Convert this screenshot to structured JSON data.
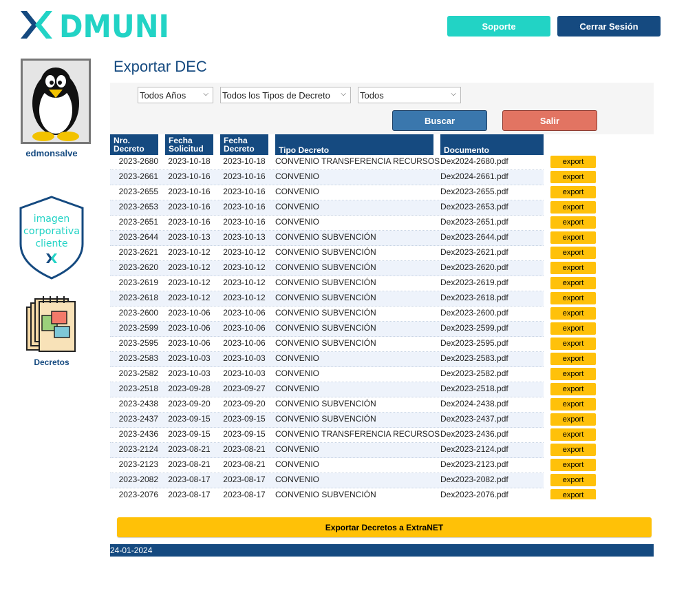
{
  "app": {
    "brand": "DMUNI"
  },
  "header": {
    "soporte_label": "Soporte",
    "cerrar_label": "Cerrar Sesión"
  },
  "sidebar": {
    "username": "edmonsalve",
    "shield_text": [
      "imagen",
      "corporativa",
      "cliente"
    ],
    "decretos_label": "Decretos"
  },
  "page": {
    "title": "Exportar DEC"
  },
  "filters": {
    "anos": "Todos Años",
    "tipos": "Todos los Tipos de Decreto",
    "todos": "Todos",
    "buscar_label": "Buscar",
    "salir_label": "Salir"
  },
  "table": {
    "headers": {
      "nro": [
        "Nro.",
        "Decreto"
      ],
      "solicitud": [
        "Fecha",
        "Solicitud"
      ],
      "decreto": [
        "Fecha",
        "Decreto"
      ],
      "tipo": "Tipo Decreto",
      "documento": "Documento"
    },
    "export_label": "export",
    "rows": [
      {
        "nro": "2023-2680",
        "solicitud": "2023-10-18",
        "decreto": "2023-10-18",
        "tipo": "CONVENIO TRANSFERENCIA RECURSOS",
        "documento": "Dex2024-2680.pdf"
      },
      {
        "nro": "2023-2661",
        "solicitud": "2023-10-16",
        "decreto": "2023-10-16",
        "tipo": "CONVENIO",
        "documento": "Dex2024-2661.pdf"
      },
      {
        "nro": "2023-2655",
        "solicitud": "2023-10-16",
        "decreto": "2023-10-16",
        "tipo": "CONVENIO",
        "documento": "Dex2023-2655.pdf"
      },
      {
        "nro": "2023-2653",
        "solicitud": "2023-10-16",
        "decreto": "2023-10-16",
        "tipo": "CONVENIO",
        "documento": "Dex2023-2653.pdf"
      },
      {
        "nro": "2023-2651",
        "solicitud": "2023-10-16",
        "decreto": "2023-10-16",
        "tipo": "CONVENIO",
        "documento": "Dex2023-2651.pdf"
      },
      {
        "nro": "2023-2644",
        "solicitud": "2023-10-13",
        "decreto": "2023-10-13",
        "tipo": "CONVENIO SUBVENCIÓN",
        "documento": "Dex2023-2644.pdf"
      },
      {
        "nro": "2023-2621",
        "solicitud": "2023-10-12",
        "decreto": "2023-10-12",
        "tipo": "CONVENIO SUBVENCIÓN",
        "documento": "Dex2023-2621.pdf"
      },
      {
        "nro": "2023-2620",
        "solicitud": "2023-10-12",
        "decreto": "2023-10-12",
        "tipo": "CONVENIO SUBVENCIÓN",
        "documento": "Dex2023-2620.pdf"
      },
      {
        "nro": "2023-2619",
        "solicitud": "2023-10-12",
        "decreto": "2023-10-12",
        "tipo": "CONVENIO SUBVENCIÓN",
        "documento": "Dex2023-2619.pdf"
      },
      {
        "nro": "2023-2618",
        "solicitud": "2023-10-12",
        "decreto": "2023-10-12",
        "tipo": "CONVENIO SUBVENCIÓN",
        "documento": "Dex2023-2618.pdf"
      },
      {
        "nro": "2023-2600",
        "solicitud": "2023-10-06",
        "decreto": "2023-10-06",
        "tipo": "CONVENIO SUBVENCIÓN",
        "documento": "Dex2023-2600.pdf"
      },
      {
        "nro": "2023-2599",
        "solicitud": "2023-10-06",
        "decreto": "2023-10-06",
        "tipo": "CONVENIO SUBVENCIÓN",
        "documento": "Dex2023-2599.pdf"
      },
      {
        "nro": "2023-2595",
        "solicitud": "2023-10-06",
        "decreto": "2023-10-06",
        "tipo": "CONVENIO SUBVENCIÓN",
        "documento": "Dex2023-2595.pdf"
      },
      {
        "nro": "2023-2583",
        "solicitud": "2023-10-03",
        "decreto": "2023-10-03",
        "tipo": "CONVENIO",
        "documento": "Dex2023-2583.pdf"
      },
      {
        "nro": "2023-2582",
        "solicitud": "2023-10-03",
        "decreto": "2023-10-03",
        "tipo": "CONVENIO",
        "documento": "Dex2023-2582.pdf"
      },
      {
        "nro": "2023-2518",
        "solicitud": "2023-09-28",
        "decreto": "2023-09-27",
        "tipo": "CONVENIO",
        "documento": "Dex2023-2518.pdf"
      },
      {
        "nro": "2023-2438",
        "solicitud": "2023-09-20",
        "decreto": "2023-09-20",
        "tipo": "CONVENIO SUBVENCIÓN",
        "documento": "Dex2024-2438.pdf"
      },
      {
        "nro": "2023-2437",
        "solicitud": "2023-09-15",
        "decreto": "2023-09-15",
        "tipo": "CONVENIO SUBVENCIÓN",
        "documento": "Dex2023-2437.pdf"
      },
      {
        "nro": "2023-2436",
        "solicitud": "2023-09-15",
        "decreto": "2023-09-15",
        "tipo": "CONVENIO TRANSFERENCIA RECURSOS",
        "documento": "Dex2023-2436.pdf"
      },
      {
        "nro": "2023-2124",
        "solicitud": "2023-08-21",
        "decreto": "2023-08-21",
        "tipo": "CONVENIO",
        "documento": "Dex2023-2124.pdf"
      },
      {
        "nro": "2023-2123",
        "solicitud": "2023-08-21",
        "decreto": "2023-08-21",
        "tipo": "CONVENIO",
        "documento": "Dex2023-2123.pdf"
      },
      {
        "nro": "2023-2082",
        "solicitud": "2023-08-17",
        "decreto": "2023-08-17",
        "tipo": "CONVENIO",
        "documento": "Dex2023-2082.pdf"
      },
      {
        "nro": "2023-2076",
        "solicitud": "2023-08-17",
        "decreto": "2023-08-17",
        "tipo": "CONVENIO SUBVENCIÓN",
        "documento": "Dex2023-2076.pdf"
      }
    ]
  },
  "actions": {
    "export_all_label": "Exportar Decretos a ExtraNET"
  },
  "footer": {
    "date": "24-01-2024"
  },
  "colors": {
    "navy": "#154a80",
    "teal": "#22d3c5",
    "yellow": "#ffc107",
    "salmon": "#e27462",
    "blue": "#3a77ad"
  }
}
